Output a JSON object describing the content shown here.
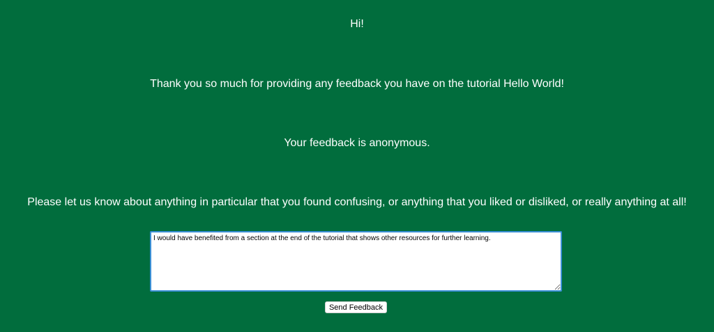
{
  "page": {
    "greeting": "Hi!",
    "thanks": "Thank you so much for providing any feedback you have on the tutorial Hello World!",
    "anonymous_note": "Your feedback is anonymous.",
    "prompt": "Please let us know about anything in particular that you found confusing, or anything that you liked or disliked, or really anything at all!"
  },
  "form": {
    "feedback_value": "I would have benefited from a section at the end of the tutorial that shows other resources for further learning.",
    "submit_label": "Send Feedback"
  },
  "colors": {
    "background": "#016d3d",
    "text": "#ffffff",
    "focus_border": "#3b8fd6"
  }
}
